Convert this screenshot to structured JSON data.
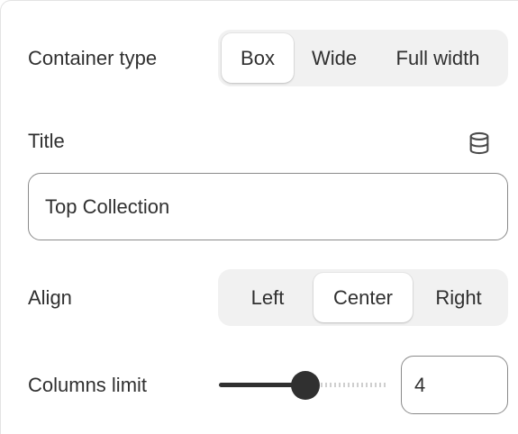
{
  "container_type": {
    "label": "Container type",
    "options": [
      "Box",
      "Wide",
      "Full width"
    ],
    "selected": "Box"
  },
  "title": {
    "label": "Title",
    "value": "Top Collection",
    "icon": "database-icon"
  },
  "align": {
    "label": "Align",
    "options": [
      "Left",
      "Center",
      "Right"
    ],
    "selected": "Center"
  },
  "columns_limit": {
    "label": "Columns limit",
    "value": "4",
    "slider_fraction": 0.5
  },
  "colors": {
    "text": "#303030",
    "segment_bg": "#f1f1f1",
    "slider": "#303030",
    "border": "#8a8a8a"
  }
}
